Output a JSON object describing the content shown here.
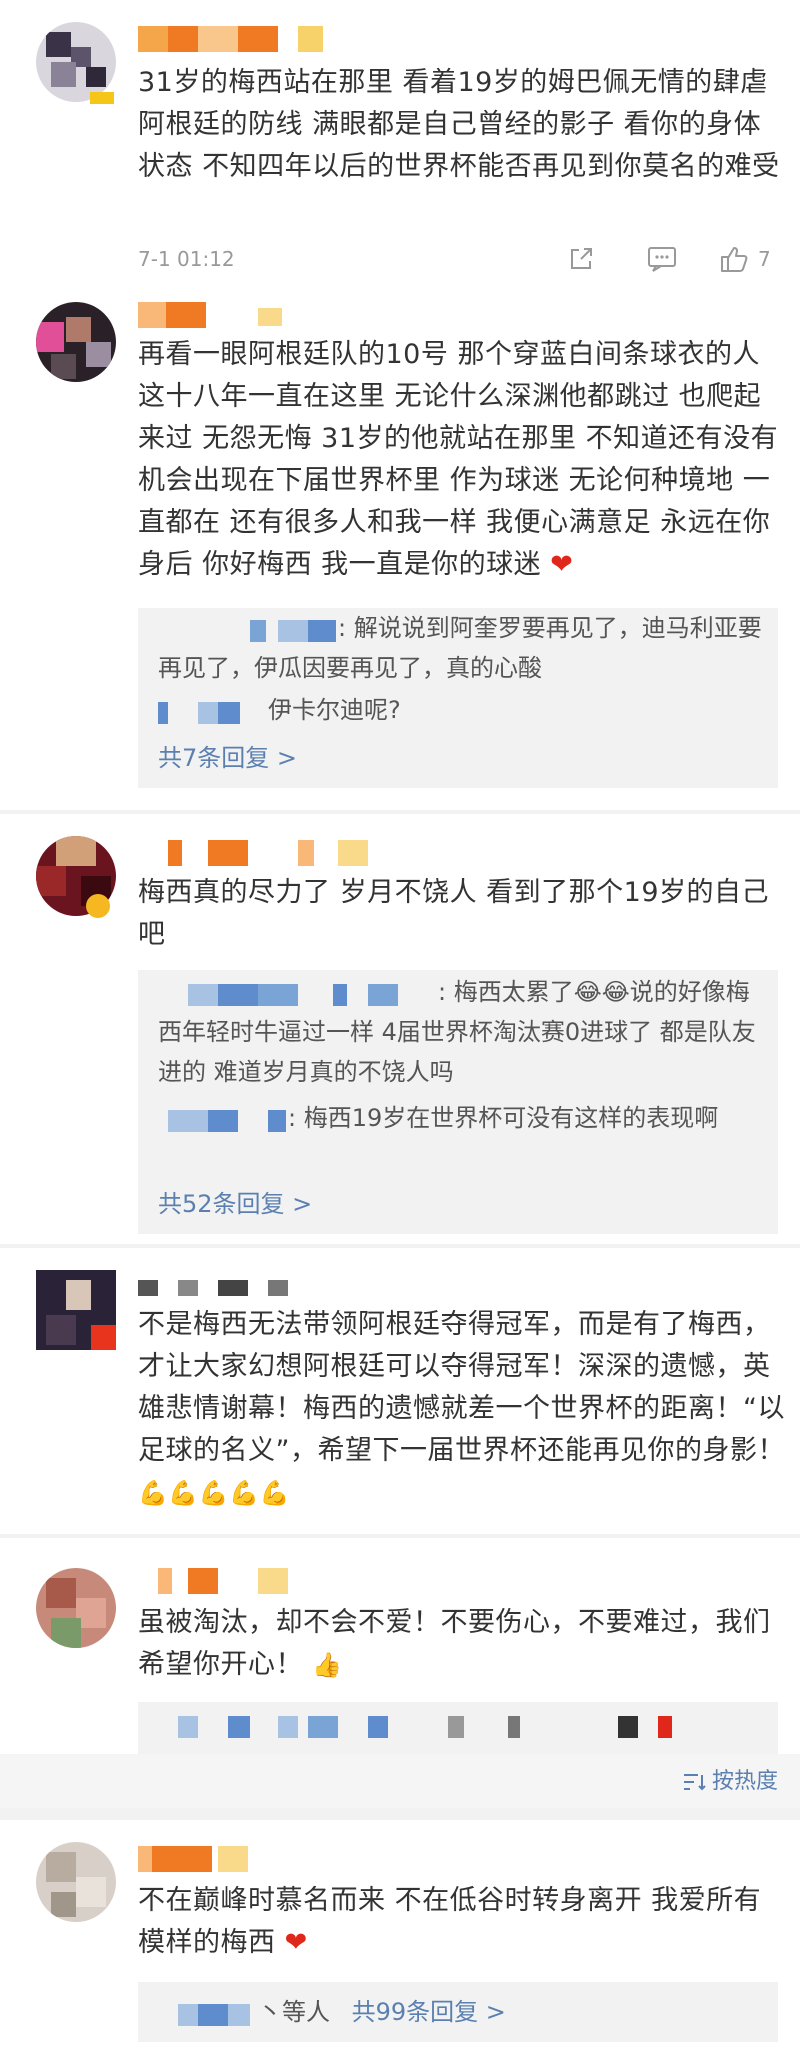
{
  "comments": [
    {
      "text": "31岁的梅西站在那里  看着19岁的姆巴佩无情的肆虐阿根廷的防线  满眼都是自己曾经的影子 看你的身体状态  不知四年以后的世界杯能否再见到你莫名的难受",
      "time": "7-1 01:12",
      "likes": "7"
    },
    {
      "text": "再看一眼阿根廷队的10号 那个穿蓝白间条球衣的人 这十八年一直在这里 无论什么深渊他都跳过 也爬起来过 无怨无悔 31岁的他就站在那里 不知道还有没有机会出现在下届世界杯里 作为球迷 无论何种境地 一直都在 还有很多人和我一样 我便心满意足 永远在你身后  你好梅西 我一直是你的球迷",
      "heart": "❤",
      "replies": [
        ": 解说说到阿奎罗要再见了，迪马利亚要再见了，伊瓜因要再见了，真的心酸",
        "伊卡尔迪呢?"
      ],
      "more": "共7条回复 >"
    },
    {
      "text": "梅西真的尽力了 岁月不饶人 看到了那个19岁的自己吧",
      "replies": [
        ": 梅西太累了😂😂说的好像梅西年轻时牛逼过一样  4届世界杯淘汰赛0进球了  都是队友进的  难道岁月真的不饶人吗",
        ": 梅西19岁在世界杯可没有这样的表现啊"
      ],
      "more": "共52条回复 >"
    },
    {
      "text": "不是梅西无法带领阿根廷夺得冠军，而是有了梅西，才让大家幻想阿根廷可以夺得冠军！深深的遗憾，英雄悲情谢幕！梅西的遗憾就差一个世界杯的距离！“以足球的名义”，希望下一届世界杯还能再见你的身影！",
      "emoji": "💪💪💪💪💪"
    },
    {
      "text": "虽被淘汰，却不会不爱！不要伤心，不要难过，我们希望你开心！",
      "emoji": "👍"
    },
    {
      "text": "不在巅峰时慕名而来 不在低谷时转身离开 我爱所有模样的梅西",
      "heart": "❤",
      "reply_suffix": "丶等人",
      "more": "共99条回复 >"
    }
  ],
  "sort_label": "按热度",
  "icons": {
    "share": "share-icon",
    "comment": "comment-icon",
    "like": "thumbs-up-icon",
    "sort": "sort-icon"
  },
  "colors": {
    "link": "#5b80b0",
    "heart": "#e0271b",
    "muted": "#999999"
  }
}
